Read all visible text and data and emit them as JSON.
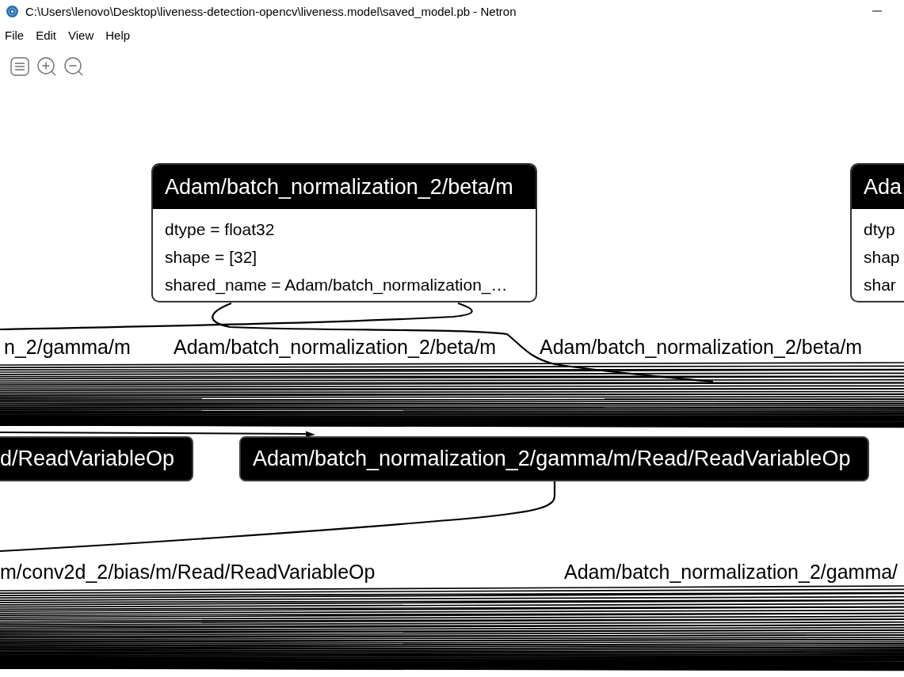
{
  "window": {
    "title": "C:\\Users\\lenovo\\Desktop\\liveness-detection-opencv\\liveness.model\\saved_model.pb - Netron"
  },
  "menu_bar": [
    "File",
    "Edit",
    "View",
    "Help"
  ],
  "graph": {
    "nodes": [
      {
        "kind": "attributes",
        "title": "Adam/batch_normalization_2/beta/m",
        "attributes": [
          "dtype = float32",
          "shape = [32]",
          "shared_name = Adam/batch_normalization_…"
        ]
      },
      {
        "kind": "attributes",
        "title": "Ada",
        "attributes": [
          "dtyp",
          "shap",
          "shar"
        ]
      },
      {
        "kind": "operator",
        "title": "d/ReadVariableOp"
      },
      {
        "kind": "operator",
        "title": "Adam/batch_normalization_2/gamma/m/Read/ReadVariableOp"
      }
    ],
    "edge_labels": [
      "n_2/gamma/m",
      "Adam/batch_normalization_2/beta/m",
      "Adam/batch_normalization_2/beta/m",
      "m/conv2d_2/bias/m/Read/ReadVariableOp",
      "Adam/batch_normalization_2/gamma/"
    ]
  }
}
